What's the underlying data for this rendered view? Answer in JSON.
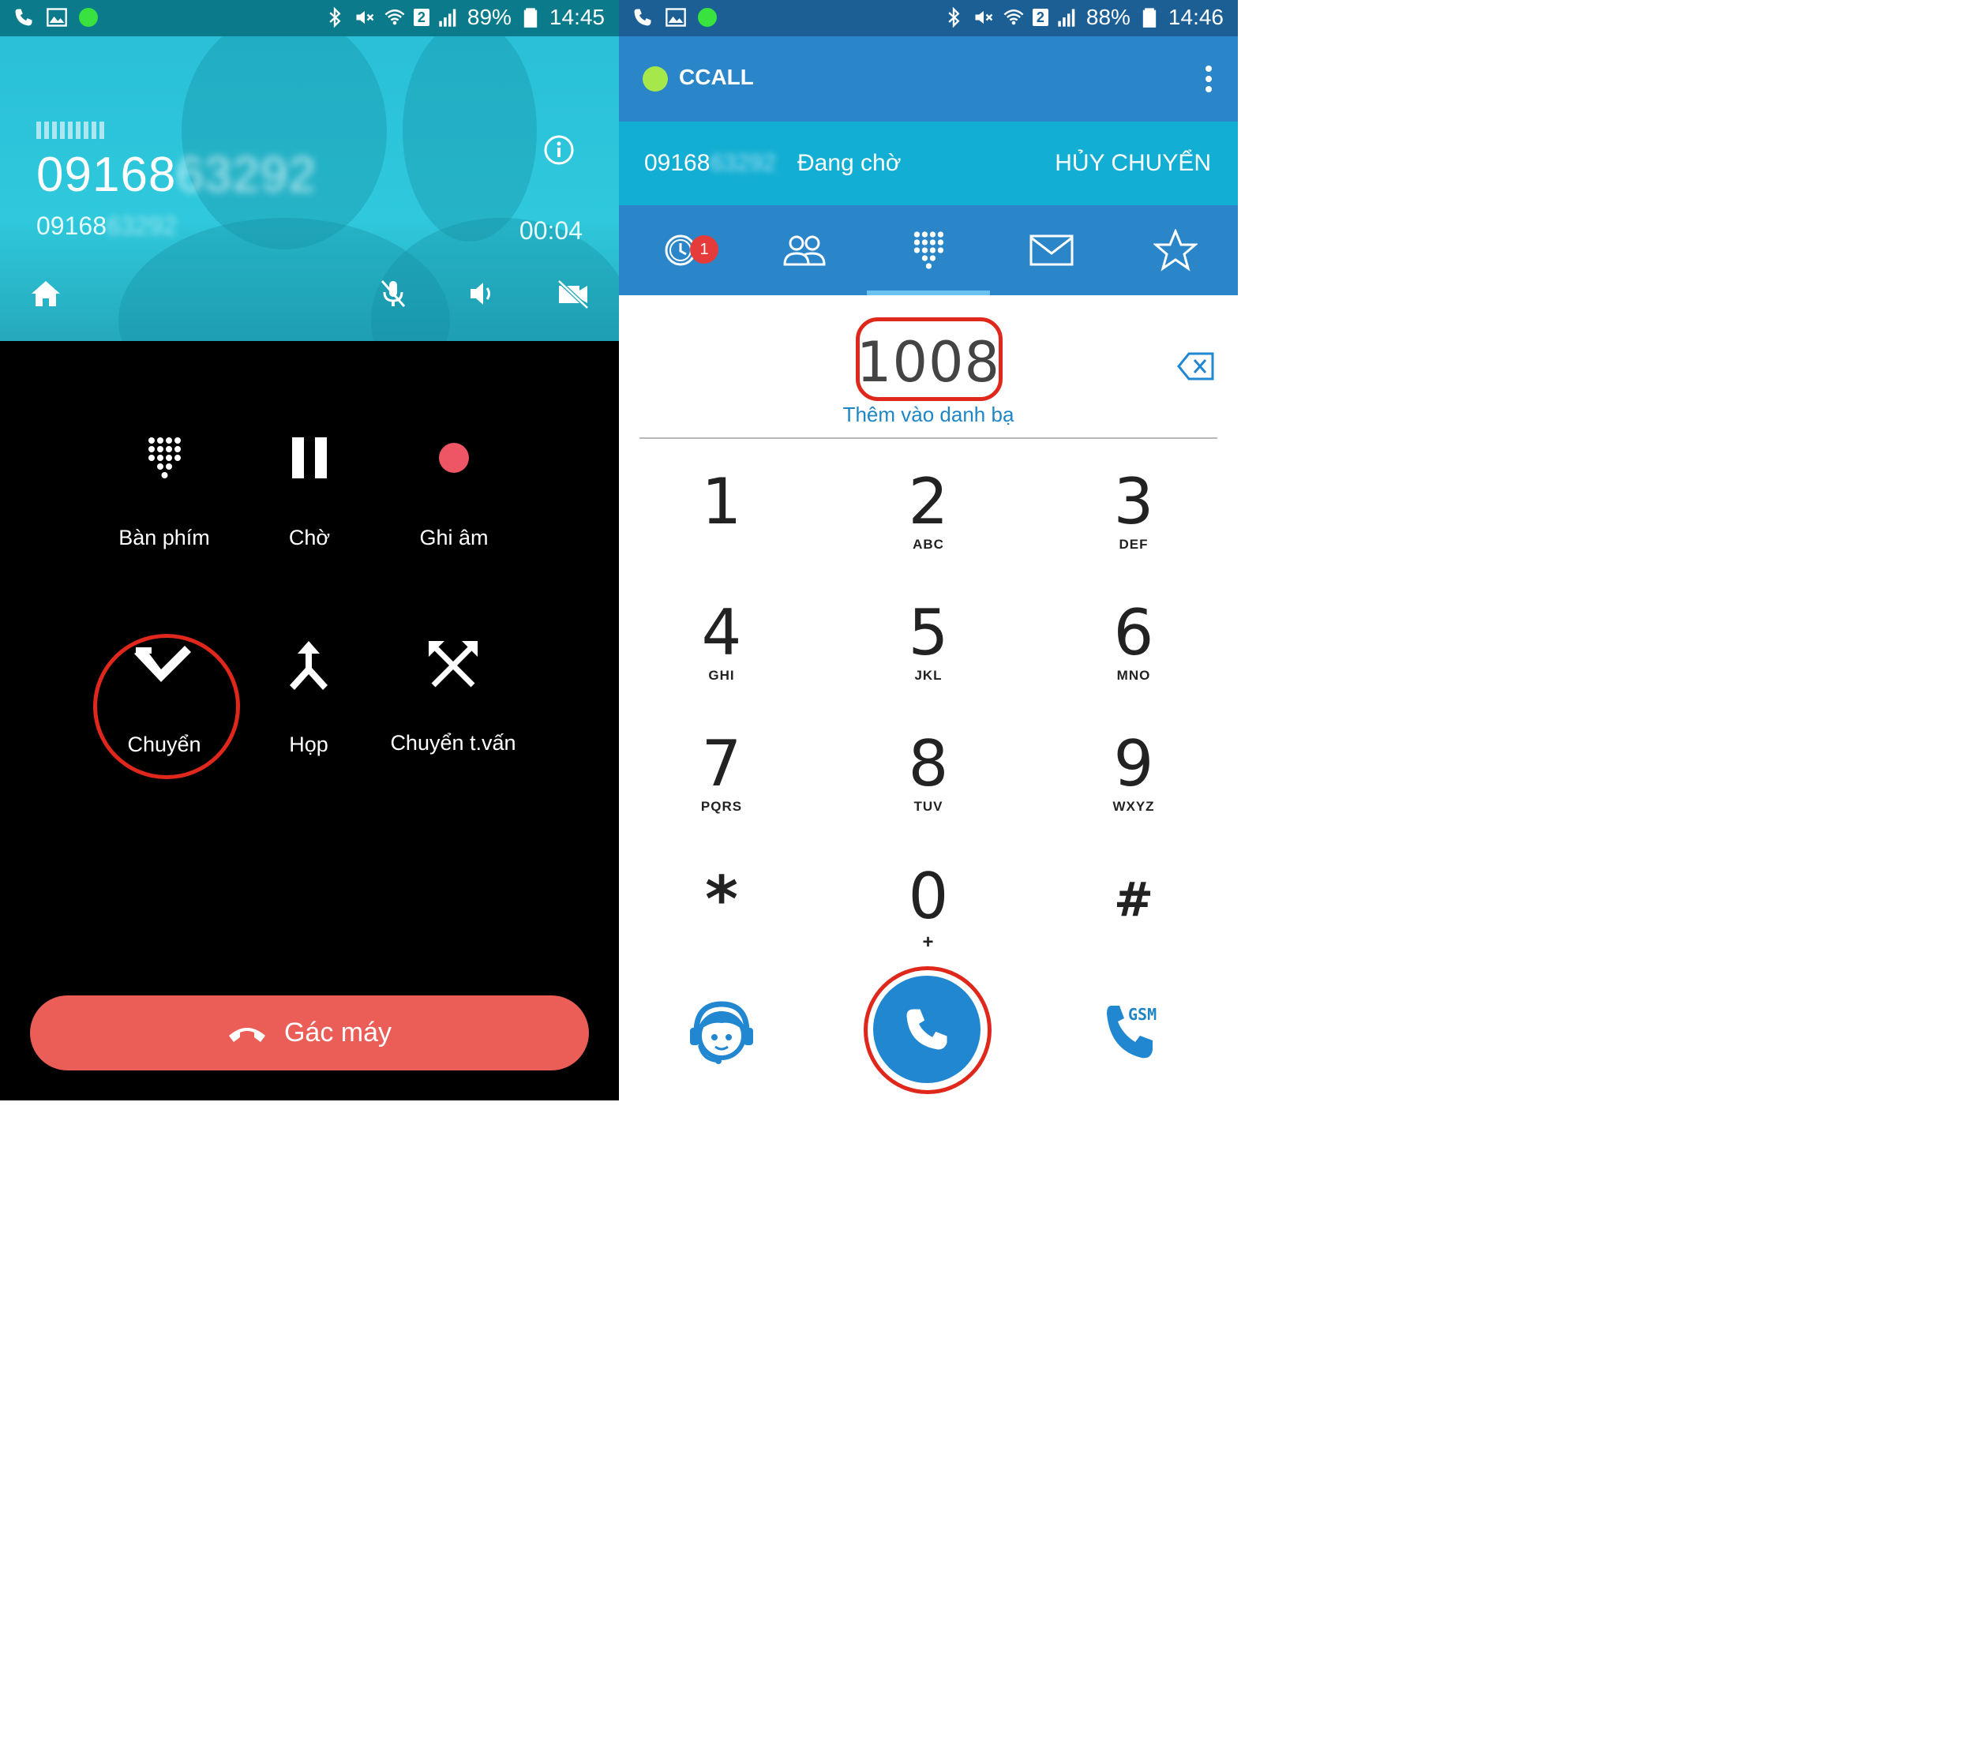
{
  "left_screen": {
    "status_bar": {
      "battery": "89%",
      "time": "14:45",
      "sim_slot": "2"
    },
    "caller": {
      "number_visible": "09168",
      "number_hidden": "63292",
      "sub_visible": "09168",
      "sub_hidden": "63292",
      "timer": "00:04"
    },
    "actions": {
      "keypad_label": "Bàn phím",
      "hold_label": "Chờ",
      "record_label": "Ghi âm",
      "transfer_label": "Chuyển",
      "conference_label": "Họp",
      "consult_transfer_label": "Chuyển t.vấn"
    },
    "hangup_label": "Gác máy"
  },
  "right_screen": {
    "status_bar": {
      "battery": "88%",
      "time": "14:46",
      "sim_slot": "2"
    },
    "app_title": "CCALL",
    "transfer_bar": {
      "number_visible": "09168",
      "number_hidden": "63292",
      "status": "Đang chờ",
      "cancel_label": "HỦY CHUYỂN"
    },
    "tabs": [
      "recent-calls",
      "contacts",
      "dialpad",
      "messages",
      "favorites"
    ],
    "recent_badge": "1",
    "active_tab": "dialpad",
    "dialed_number": "1008",
    "add_contact_label": "Thêm vào danh bạ",
    "keys": [
      {
        "digit": "1",
        "letters": ""
      },
      {
        "digit": "2",
        "letters": "ABC"
      },
      {
        "digit": "3",
        "letters": "DEF"
      },
      {
        "digit": "4",
        "letters": "GHI"
      },
      {
        "digit": "5",
        "letters": "JKL"
      },
      {
        "digit": "6",
        "letters": "MNO"
      },
      {
        "digit": "7",
        "letters": "PQRS"
      },
      {
        "digit": "8",
        "letters": "TUV"
      },
      {
        "digit": "9",
        "letters": "WXYZ"
      },
      {
        "digit": "*",
        "letters": ""
      },
      {
        "digit": "0",
        "letters": "+"
      },
      {
        "digit": "#",
        "letters": ""
      }
    ],
    "gsm_label": "GSM"
  },
  "colors": {
    "hangup": "#ea5e57",
    "app_bar": "#2a86c8",
    "transfer_bar": "#13aed3",
    "highlight": "#e0271c",
    "call_button": "#2187d0",
    "record_dot": "#ee5565"
  }
}
